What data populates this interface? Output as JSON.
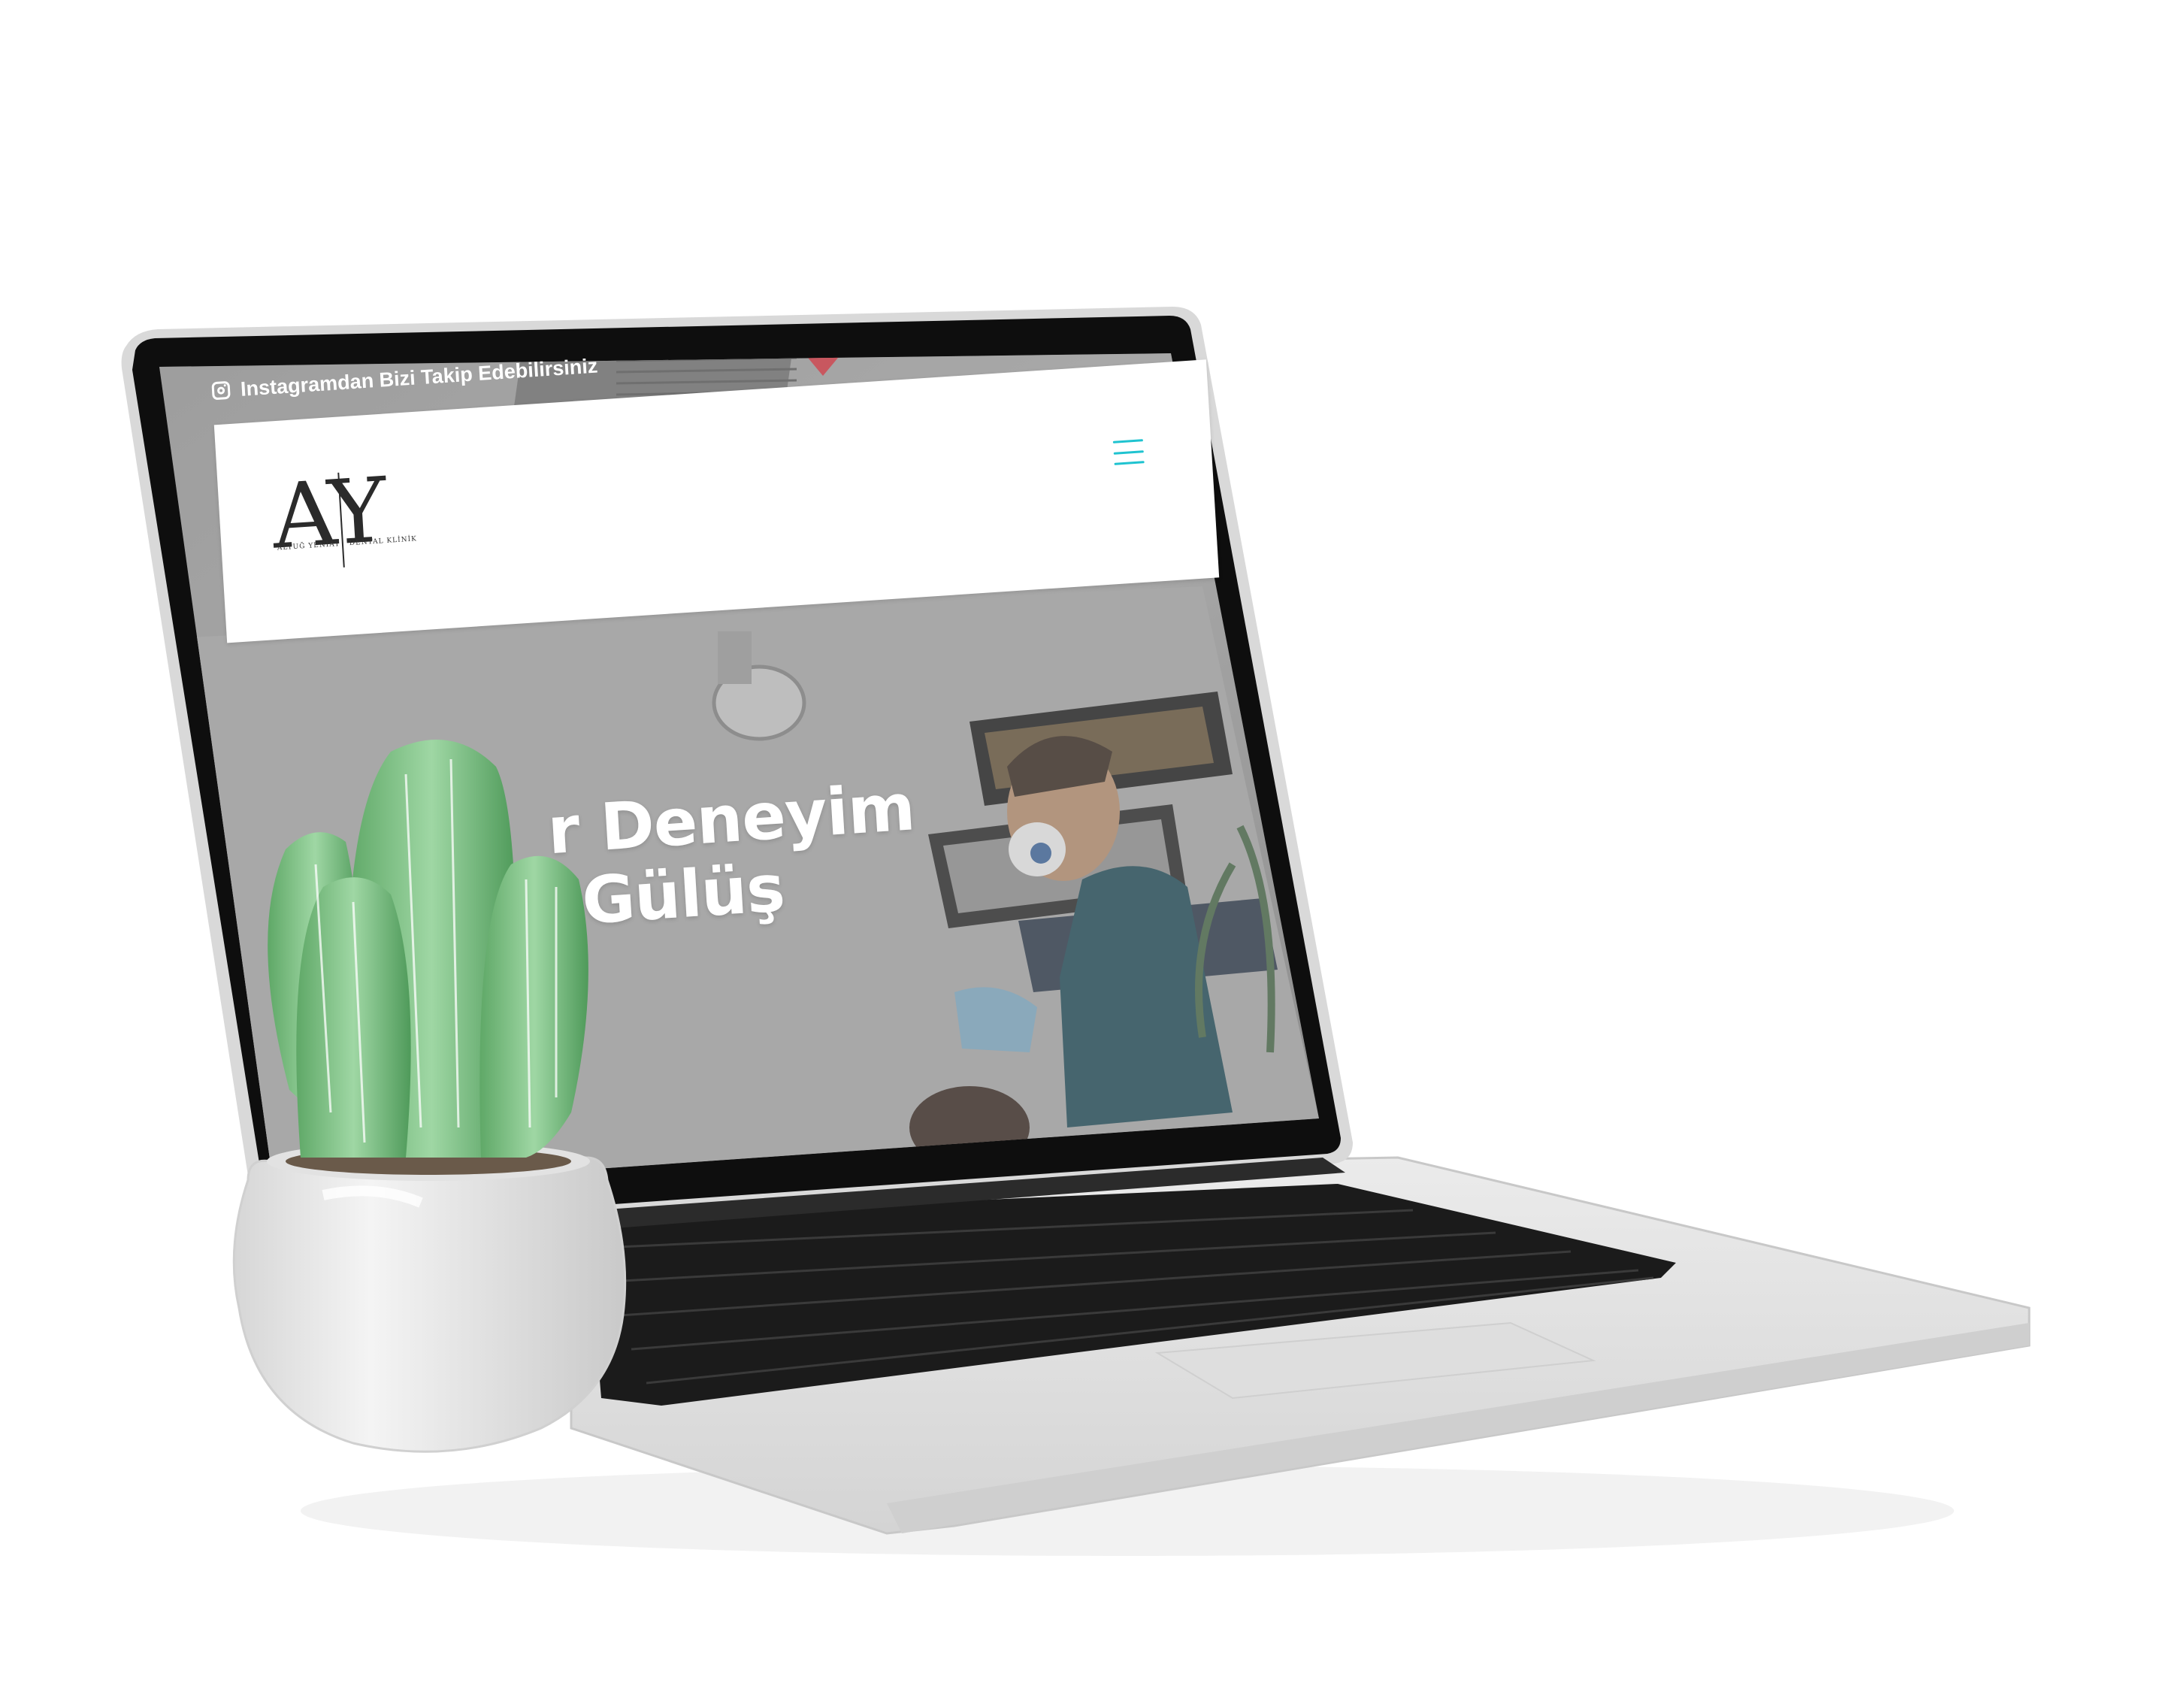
{
  "topbar": {
    "instagram_text": "Instagramdan Bizi Takip Edebilirsiniz"
  },
  "header": {
    "logo_letters": "AY",
    "logo_left_caption": "ALTUĞ YENİAY",
    "logo_right_caption": "DENTAL KLİNİK"
  },
  "hero": {
    "line1": "r Deneyim",
    "line2": "Gülüş"
  },
  "colors": {
    "menu_accent": "#1fc3d0",
    "hero_overlay": "#8f8f8f",
    "scrubs": "#1f4f5c",
    "cactus": "#7ec287"
  },
  "icons": {
    "instagram": "instagram-icon",
    "menu": "hamburger-menu-icon"
  }
}
